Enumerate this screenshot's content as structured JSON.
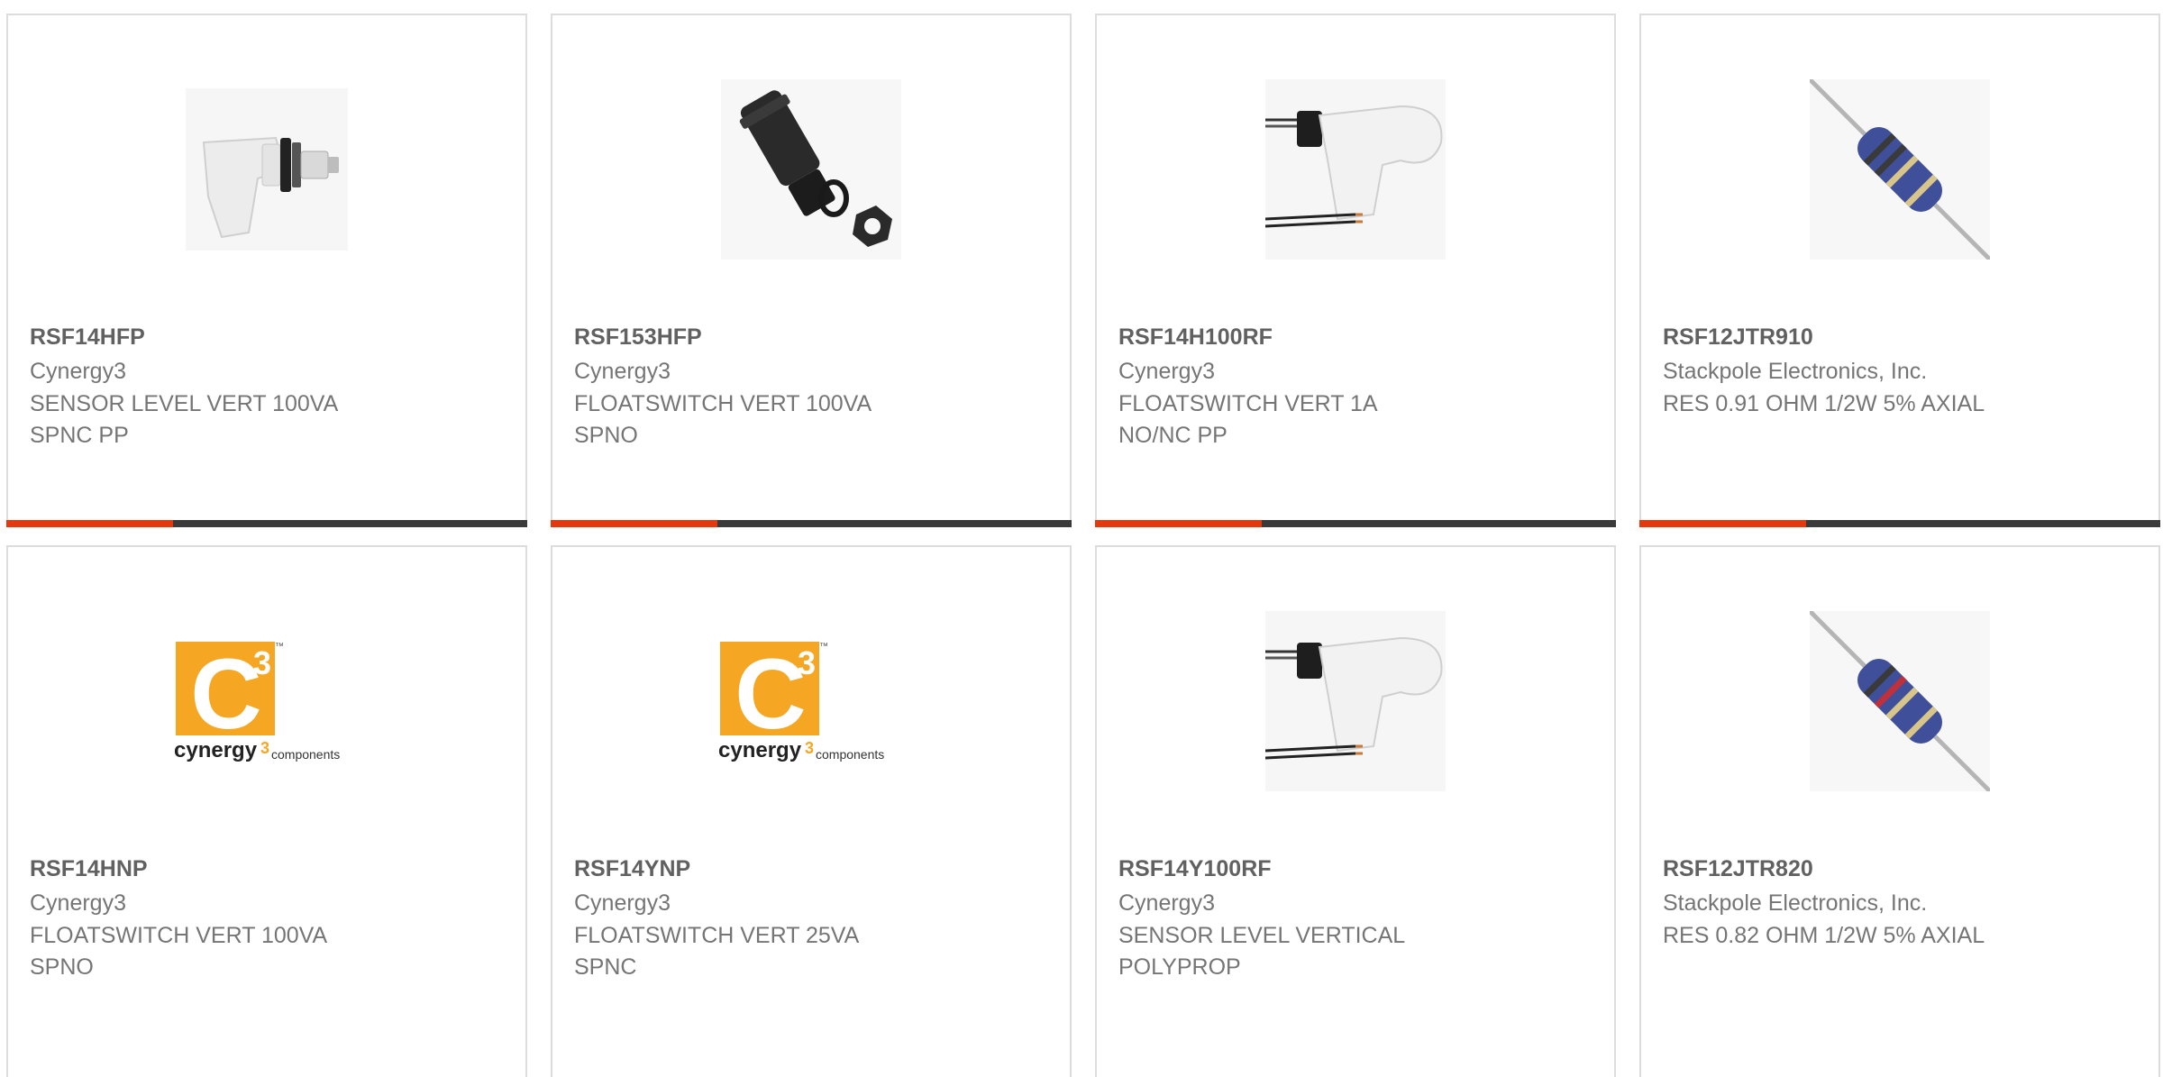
{
  "products": [
    {
      "part": "RSF14HFP",
      "manufacturer": "Cynergy3",
      "desc1": "SENSOR LEVEL VERT 100VA",
      "desc2": "SPNC PP",
      "image": "float-switch-horizontal-icon"
    },
    {
      "part": "RSF153HFP",
      "manufacturer": "Cynergy3",
      "desc1": "FLOATSWITCH VERT 100VA",
      "desc2": "SPNO",
      "image": "black-float-switch-icon"
    },
    {
      "part": "RSF14H100RF",
      "manufacturer": "Cynergy3",
      "desc1": "FLOATSWITCH VERT 1A",
      "desc2": "NO/NC PP",
      "image": "float-switch-wired-icon"
    },
    {
      "part": "RSF12JTR910",
      "manufacturer": "Stackpole Electronics, Inc.",
      "desc1": "RES 0.91 OHM 1/2W 5% AXIAL",
      "desc2": "",
      "image": "axial-resistor-icon"
    },
    {
      "part": "RSF14HNP",
      "manufacturer": "Cynergy3",
      "desc1": "FLOATSWITCH VERT 100VA",
      "desc2": "SPNO",
      "image": "cynergy3-logo-icon"
    },
    {
      "part": "RSF14YNP",
      "manufacturer": "Cynergy3",
      "desc1": "FLOATSWITCH VERT 25VA",
      "desc2": "SPNC",
      "image": "cynergy3-logo-icon"
    },
    {
      "part": "RSF14Y100RF",
      "manufacturer": "Cynergy3",
      "desc1": "SENSOR LEVEL VERTICAL",
      "desc2": "POLYPROP",
      "image": "float-switch-wired-icon"
    },
    {
      "part": "RSF12JTR820",
      "manufacturer": "Stackpole Electronics, Inc.",
      "desc1": "RES 0.82 OHM 1/2W 5% AXIAL",
      "desc2": "",
      "image": "axial-resistor-icon"
    }
  ],
  "logo": {
    "mark": "C",
    "superscript": "3",
    "trademark": "™",
    "wordmark": "cynergy",
    "wordmark_sub": "3",
    "wordmark_suffix": "components"
  },
  "progress": {
    "fraction": 0.32
  },
  "colors": {
    "accent": "#e4380f",
    "track": "#3a3a3a",
    "logo_orange": "#f5a623"
  }
}
